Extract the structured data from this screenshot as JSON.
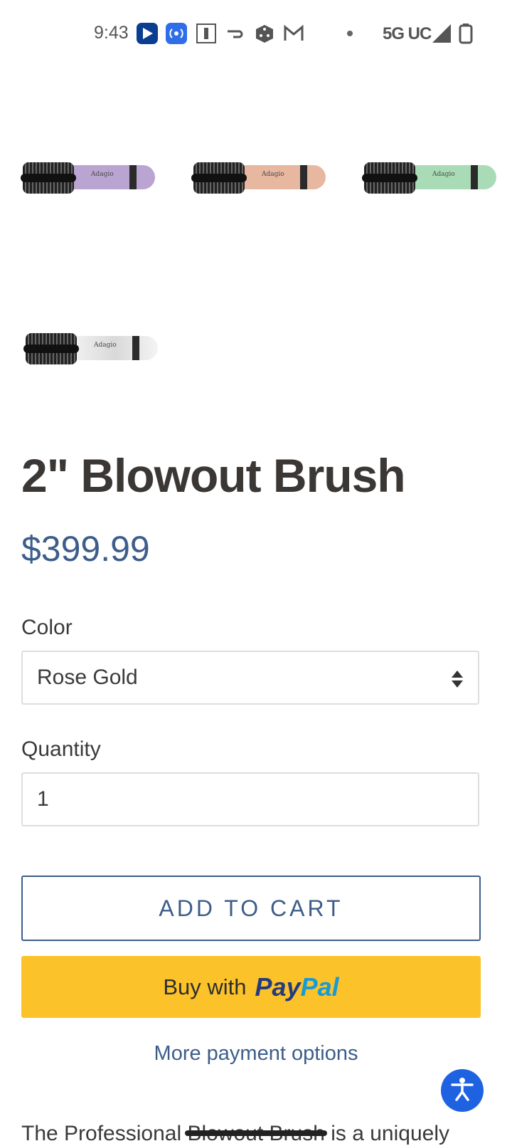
{
  "status_bar": {
    "time": "9:43",
    "network": "5G UC",
    "icons": [
      "play-store-icon",
      "wireless-icon",
      "chess-icon",
      "doordash-icon",
      "dice-icon",
      "gmail-icon",
      "dot-icon",
      "signal-icon",
      "battery-icon"
    ]
  },
  "gallery": {
    "thumbnails": [
      {
        "name": "purple",
        "handle_color": "#b9a4d2",
        "logo": "Adagio"
      },
      {
        "name": "rose-gold",
        "handle_color": "#e7b7a0",
        "logo": "Adagio"
      },
      {
        "name": "green",
        "handle_color": "#a9dcb6",
        "logo": "Adagio"
      },
      {
        "name": "white-marble",
        "handle_color": "#e8e8e8",
        "logo": "Adagio"
      }
    ]
  },
  "product": {
    "title": "2\" Blowout Brush",
    "price": "$399.99"
  },
  "options": {
    "color_label": "Color",
    "color_value": "Rose Gold",
    "quantity_label": "Quantity",
    "quantity_value": "1"
  },
  "actions": {
    "add_to_cart": "ADD TO CART",
    "paypal_buy": "Buy with",
    "paypal_pay": "Pay",
    "paypal_pal": "Pal",
    "more_payment": "More payment options"
  },
  "description": {
    "text": "The Professional Blowout Brush is a uniquely"
  },
  "colors": {
    "accent": "#3d5d8a",
    "paypal_yellow": "#fcc229",
    "accessibility_blue": "#1e62e2"
  }
}
